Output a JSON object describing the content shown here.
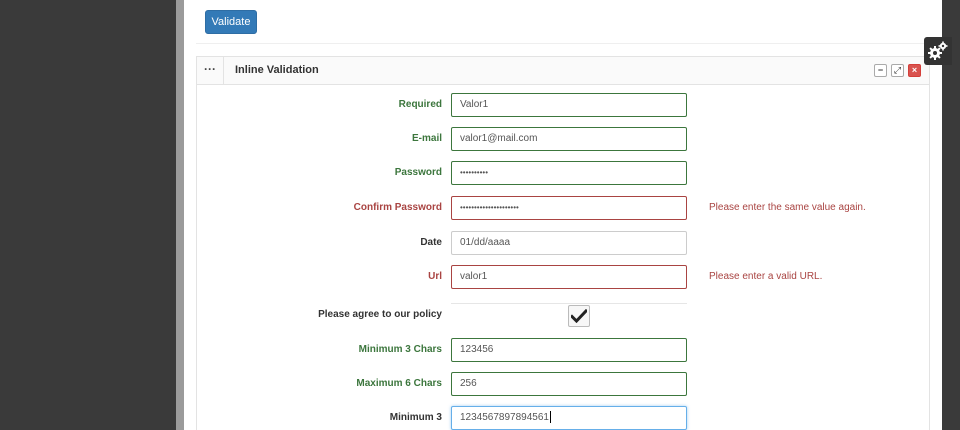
{
  "toolbar": {
    "validate_label": "Validate"
  },
  "panel": {
    "handle": "···",
    "title": "Inline Validation",
    "controls": {
      "minimize": "−",
      "expand": "⤢",
      "close": "×"
    }
  },
  "fields": {
    "required": {
      "label": "Required",
      "value": "Valor1"
    },
    "email": {
      "label": "E-mail",
      "value": "valor1@mail.com"
    },
    "password": {
      "label": "Password",
      "value": "••••••••••"
    },
    "confirm": {
      "label": "Confirm Password",
      "value": "•••••••••••••••••••••",
      "error": "Please enter the same value again."
    },
    "date": {
      "label": "Date",
      "value": "01/dd/aaaa"
    },
    "url": {
      "label": "Url",
      "value": "valor1",
      "error": "Please enter a valid URL."
    },
    "policy": {
      "label": "Please agree to our policy",
      "checked": true
    },
    "min3chars": {
      "label": "Minimum 3 Chars",
      "value": "123456"
    },
    "max6chars": {
      "label": "Maximum 6 Chars",
      "value": "256"
    },
    "min3": {
      "label": "Minimum 3",
      "value": "1234567897894561"
    }
  },
  "colors": {
    "primary": "#337ab7",
    "success": "#3c763d",
    "error": "#a94442",
    "focus": "#66afe9",
    "sidebar": "#3a3a3a"
  },
  "icons": {
    "settings": "gears-icon",
    "checkmark": "checkmark-icon"
  }
}
